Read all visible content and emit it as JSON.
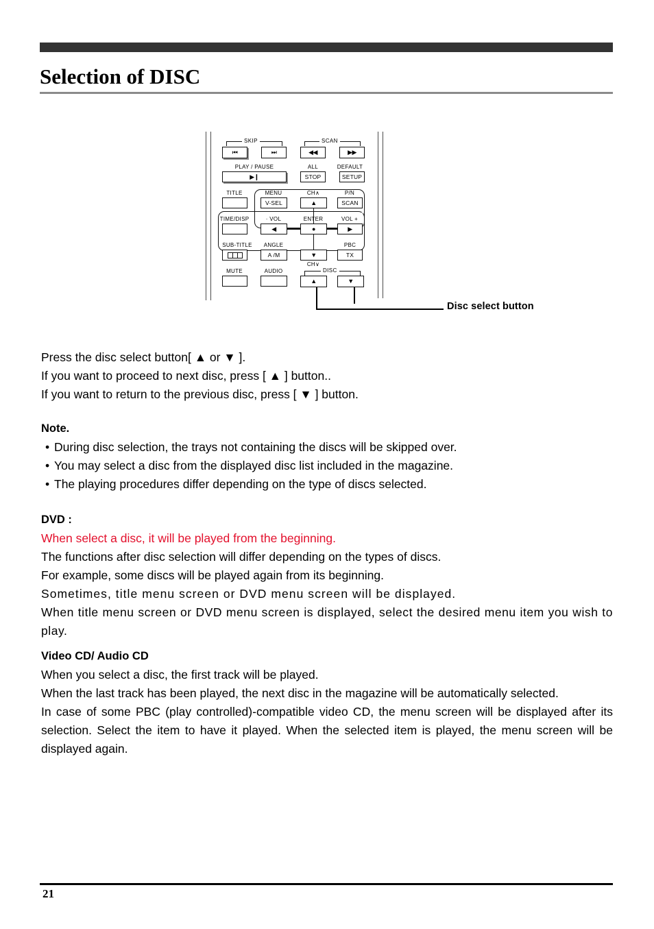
{
  "page": {
    "title": "Selection of DISC",
    "number": "21"
  },
  "diagram": {
    "callout_label": "Disc select button",
    "group_labels": {
      "skip": "SKIP",
      "scan": "SCAN",
      "disc": "DISC"
    },
    "buttons": [
      {
        "top_label": "",
        "face": "⏮",
        "name": "skip-back"
      },
      {
        "top_label": "",
        "face": "⏭",
        "name": "skip-forward"
      },
      {
        "top_label": "",
        "face": "◀◀",
        "name": "scan-back"
      },
      {
        "top_label": "",
        "face": "▶▶",
        "name": "scan-forward"
      },
      {
        "top_label": "PLAY / PAUSE",
        "face": "▶❙",
        "name": "play-pause"
      },
      {
        "top_label": "ALL",
        "face": "STOP",
        "name": "stop"
      },
      {
        "top_label": "DEFAULT",
        "face": "SETUP",
        "name": "setup"
      },
      {
        "top_label": "TITLE",
        "face": "",
        "name": "title"
      },
      {
        "top_label": "MENU",
        "face": "V-SEL",
        "name": "v-sel"
      },
      {
        "top_label": "CH∧",
        "face": "▲",
        "name": "ch-up"
      },
      {
        "top_label": "P/N",
        "face": "SCAN",
        "name": "pn-scan"
      },
      {
        "top_label": "TIME/DISP",
        "face": "",
        "name": "time-disp"
      },
      {
        "top_label": "· VOL",
        "face": "◀",
        "name": "vol-down"
      },
      {
        "top_label": "ENTER",
        "face": "●",
        "name": "enter"
      },
      {
        "top_label": "VOL +",
        "face": "▶",
        "name": "vol-up"
      },
      {
        "top_label": "SUB-TITLE",
        "face": "",
        "name": "sub-title"
      },
      {
        "top_label": "ANGLE",
        "face": "A /M",
        "name": "angle"
      },
      {
        "top_label": "CH∨",
        "face": "▼",
        "name": "ch-down"
      },
      {
        "top_label": "PBC",
        "face": "TX",
        "name": "pbc-tx"
      },
      {
        "top_label": "MUTE",
        "face": "",
        "name": "mute"
      },
      {
        "top_label": "AUDIO",
        "face": "",
        "name": "audio"
      },
      {
        "top_label": "",
        "face": "▲",
        "name": "disc-up"
      },
      {
        "top_label": "",
        "face": "▼",
        "name": "disc-down"
      }
    ]
  },
  "content": {
    "intro": [
      "Press the disc select button[ ▲ or ▼  ].",
      "If you want to proceed to next disc, press [ ▲  ] button..",
      "If you want to return to the previous disc, press [ ▼  ] button."
    ],
    "note": {
      "heading": "Note.",
      "items": [
        "During disc selection, the trays not containing the discs will be skipped over.",
        "You may select a disc from the displayed disc list included in the magazine.",
        "The playing procedures differ depending on the type of discs selected."
      ]
    },
    "dvd": {
      "heading": "DVD :",
      "red_line": "When select a disc, it will be played from the beginning.",
      "lines": [
        "The functions after disc selection will differ depending on the types of discs.",
        "For example, some discs will be played again from its beginning."
      ],
      "tracked_line": "Sometimes, title menu screen or DVD menu screen will be displayed.",
      "justified_block": "When title menu screen or DVD menu screen is displayed, select the desired menu item you wish to play."
    },
    "videocd": {
      "heading": "Video CD/ Audio CD",
      "line1": "When you select a disc, the first track will be played.",
      "block1": "When the last track has been played, the next disc in the magazine will be automatically selected.",
      "block2": "In case of some PBC (play controlled)-compatible video CD, the menu screen will be displayed after its selection. Select the item to have it played. When the selected item is played, the menu screen will be displayed again."
    }
  },
  "colors": {
    "header_bar": "#333333",
    "title_rule": "#8a8a8a",
    "red_text": "#e3102c"
  }
}
